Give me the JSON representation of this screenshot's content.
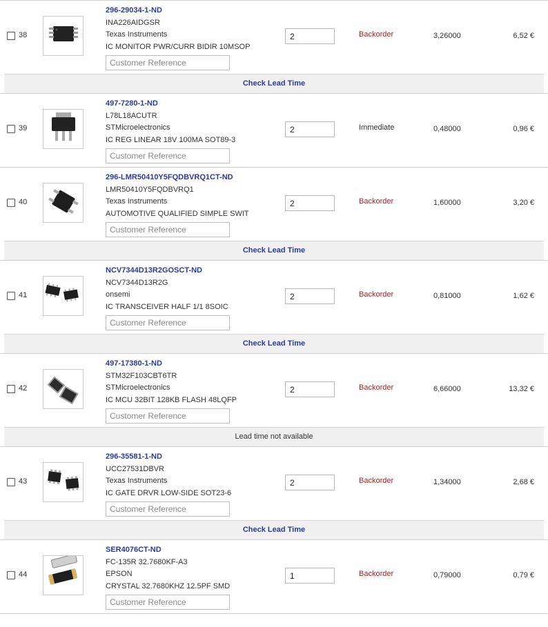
{
  "placeholder": "Customer Reference",
  "colors": {
    "part_link": "#2b3aa3",
    "backorder": "#b71c1c",
    "separator_bg": "#f0f0f0"
  },
  "items": [
    {
      "index": "38",
      "part": "296-29034-1-ND",
      "mfr_part": "INA226AIDGSR",
      "manufacturer": "Texas Instruments",
      "description": "IC MONITOR PWR/CURR BIDIR 10MSOP",
      "qty": "2",
      "availability": "Backorder",
      "unit_price": "3,26000",
      "ext_price": "6,52 €",
      "icon": "msop-chip-icon",
      "after": {
        "text": "Check Lead Time",
        "link": true
      }
    },
    {
      "index": "39",
      "part": "497-7280-1-ND",
      "mfr_part": "L78L18ACUTR",
      "manufacturer": "STMicroelectronics",
      "description": "IC REG LINEAR 18V 100MA SOT89-3",
      "qty": "2",
      "availability": "Immediate",
      "unit_price": "0,48000",
      "ext_price": "0,96 €",
      "icon": "sot89-regulator-icon",
      "after": null
    },
    {
      "index": "40",
      "part": "296-LMR50410Y5FQDBVRQ1CT-ND",
      "mfr_part": "LMR50410Y5FQDBVRQ1",
      "manufacturer": "Texas Instruments",
      "description": "AUTOMOTIVE QUALIFIED SIMPLE SWIT",
      "qty": "2",
      "availability": "Backorder",
      "unit_price": "1,60000",
      "ext_price": "3,20 €",
      "icon": "sot23-chip-icon",
      "after": {
        "text": "Check Lead Time",
        "link": true
      }
    },
    {
      "index": "41",
      "part": "NCV7344D13R2GOSCT-ND",
      "mfr_part": "NCV7344D13R2G",
      "manufacturer": "onsemi",
      "description": "IC TRANSCEIVER HALF 1/1 8SOIC",
      "qty": "2",
      "availability": "Backorder",
      "unit_price": "0,81000",
      "ext_price": "1,62 €",
      "icon": "soic-chip-icon",
      "after": {
        "text": "Check Lead Time",
        "link": true
      }
    },
    {
      "index": "42",
      "part": "497-17380-1-ND",
      "mfr_part": "STM32F103CBT6TR",
      "manufacturer": "STMicroelectronics",
      "description": "IC MCU 32BIT 128KB FLASH 48LQFP",
      "qty": "2",
      "availability": "Backorder",
      "unit_price": "6,66000",
      "ext_price": "13,32 €",
      "icon": "lqfp-chip-icon",
      "after": {
        "text": "Lead time not available",
        "link": false
      }
    },
    {
      "index": "43",
      "part": "296-35581-1-ND",
      "mfr_part": "UCC27531DBVR",
      "manufacturer": "Texas Instruments",
      "description": "IC GATE DRVR LOW-SIDE SOT23-6",
      "qty": "2",
      "availability": "Backorder",
      "unit_price": "1,34000",
      "ext_price": "2,68 €",
      "icon": "sot23-6-chip-icon",
      "after": {
        "text": "Check Lead Time",
        "link": true
      }
    },
    {
      "index": "44",
      "part": "SER4076CT-ND",
      "mfr_part": "FC-135R 32.7680KF-A3",
      "manufacturer": "EPSON",
      "description": "CRYSTAL 32.7680KHZ 12.5PF SMD",
      "qty": "1",
      "availability": "Backorder",
      "unit_price": "0,79000",
      "ext_price": "0,79 €",
      "icon": "crystal-icon",
      "after": null
    }
  ]
}
